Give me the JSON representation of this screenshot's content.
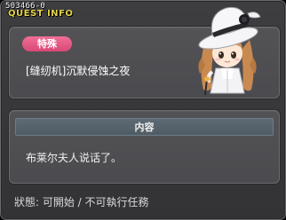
{
  "header": {
    "quest_id": "503466-0",
    "title": "QUEST INFO"
  },
  "quest": {
    "tag_label": "特殊",
    "name": "[缝纫机]沉默侵蚀之夜"
  },
  "content": {
    "header_label": "内容",
    "text": "布莱尔夫人说话了。"
  },
  "status": {
    "text": "狀態: 可開始 / 不可執行任務"
  },
  "colors": {
    "title_yellow": "#e6d34a",
    "tag_pink": "#e45a84",
    "panel_bg": "#4e4e52",
    "header_steel": "#56636d"
  },
  "icons": {
    "character": "character-portrait-white-hat-lady"
  }
}
